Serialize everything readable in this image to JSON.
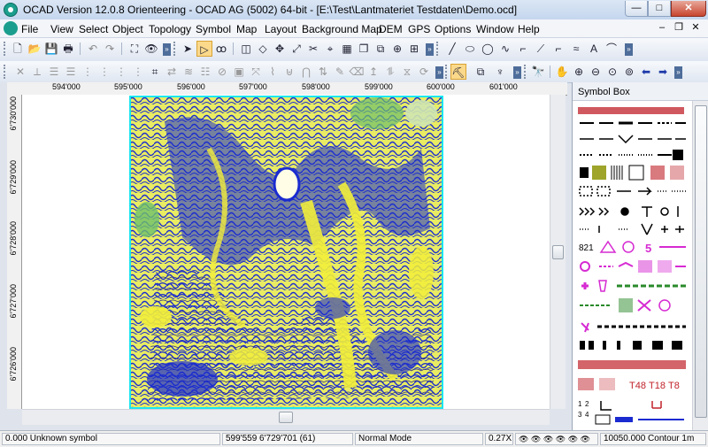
{
  "window": {
    "title": "OCAD Version 12.0.8  Orienteering - OCAD AG (5002) 64-bit - [E:\\Test\\Lantmateriet Testdaten\\Demo.ocd]",
    "minimize_glyph": "—",
    "maximize_glyph": "□",
    "close_glyph": "✕"
  },
  "menu": {
    "items": [
      "File",
      "View",
      "Select",
      "Object",
      "Topology",
      "Symbol",
      "Map",
      "Layout",
      "Background Map",
      "DEM",
      "GPS",
      "Options",
      "Window",
      "Help"
    ],
    "mdi_minimize": "–",
    "mdi_restore": "❐",
    "mdi_close": "✕"
  },
  "rulers": {
    "horizontal": [
      "594'000",
      "595'000",
      "596'000",
      "597'000",
      "598'000",
      "599'000",
      "600'000",
      "601'000"
    ],
    "vertical": [
      "6'730'000",
      "6'729'000",
      "6'728'000",
      "6'727'000",
      "6'726'000"
    ]
  },
  "symbol_box": {
    "title": "Symbol Box",
    "row_text_821": "821",
    "row_text_5": "5",
    "t48": "T48",
    "t18": "T18",
    "t8": "T8",
    "num_1": "1",
    "num_2": "2",
    "num_3": "3",
    "num_4": "4"
  },
  "statusbar": {
    "symbol": "0.000 Unknown symbol",
    "coords": "599'559   6'729'701   (61)",
    "mode": "Normal Mode",
    "zoom": "0.27X",
    "scale": "10050.000 Contour 1m"
  },
  "colors": {
    "map_blue": "#1a2bd0",
    "map_yellow": "#f2ee3a",
    "map_green": "#6fc06a",
    "map_cyan": "#19e6f0",
    "symbol_magenta": "#d62ad2",
    "symbol_red": "#c0222a"
  }
}
